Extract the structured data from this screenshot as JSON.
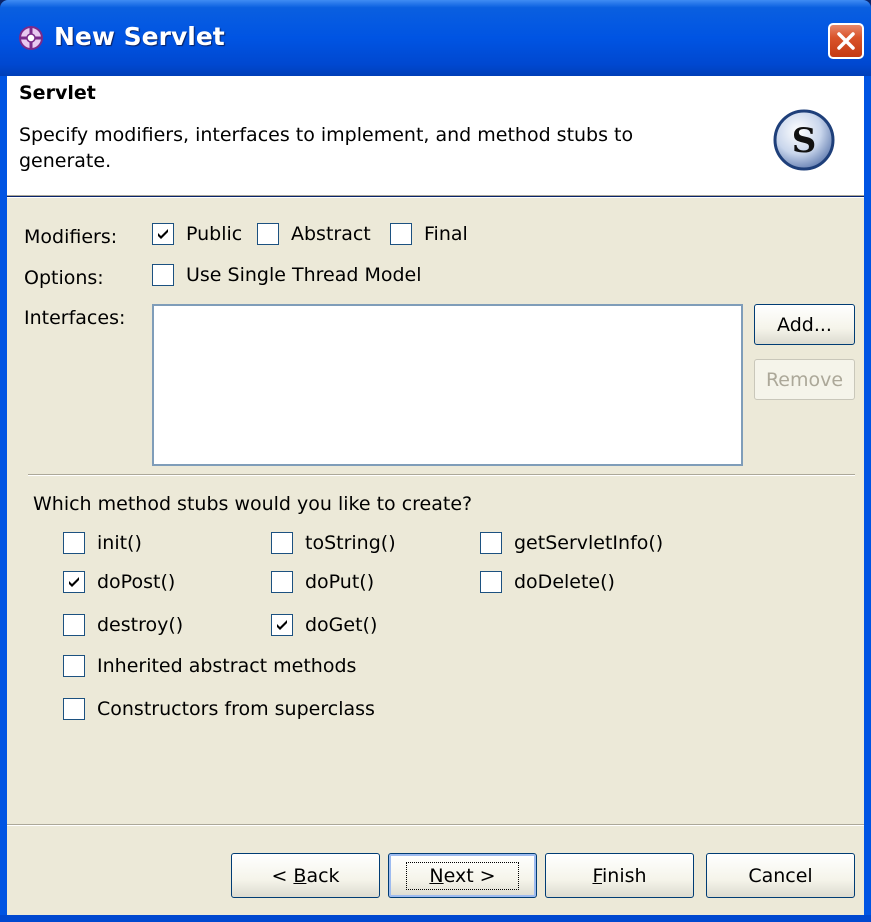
{
  "window": {
    "title": "New Servlet",
    "icon": "servlet-wizard-icon",
    "close_icon": "close-icon"
  },
  "header": {
    "title": "Servlet",
    "description": "Specify modifiers, interfaces to implement, and method stubs to generate.",
    "logo_letter": "S",
    "logo_icon": "servlet-logo-icon"
  },
  "modifiers": {
    "label": "Modifiers:",
    "items": [
      {
        "label": "Public",
        "checked": true
      },
      {
        "label": "Abstract",
        "checked": false
      },
      {
        "label": "Final",
        "checked": false
      }
    ]
  },
  "options": {
    "label": "Options:",
    "items": [
      {
        "label": "Use Single Thread Model",
        "checked": false
      }
    ]
  },
  "interfaces": {
    "label": "Interfaces:",
    "items": [],
    "add_label": "Add...",
    "remove_label": "Remove"
  },
  "stubs": {
    "question": "Which method stubs would you like to create?",
    "items": [
      {
        "label": "init()",
        "checked": false
      },
      {
        "label": "toString()",
        "checked": false
      },
      {
        "label": "getServletInfo()",
        "checked": false
      },
      {
        "label": "doPost()",
        "checked": true
      },
      {
        "label": "doPut()",
        "checked": false
      },
      {
        "label": "doDelete()",
        "checked": false
      },
      {
        "label": "destroy()",
        "checked": false
      },
      {
        "label": "doGet()",
        "checked": true
      },
      {
        "label": "Inherited abstract methods",
        "checked": false
      },
      {
        "label": "Constructors from superclass",
        "checked": false
      }
    ]
  },
  "buttons": {
    "back_prefix": "< ",
    "back_mnemonic": "B",
    "back_rest": "ack",
    "next_mnemonic": "N",
    "next_rest": "ext >",
    "finish_mnemonic": "F",
    "finish_rest": "inish",
    "cancel": "Cancel"
  },
  "colors": {
    "titlebar": "#0054e3",
    "dialog_bg": "#ece9d8",
    "checkbox_border": "#1c5180"
  }
}
